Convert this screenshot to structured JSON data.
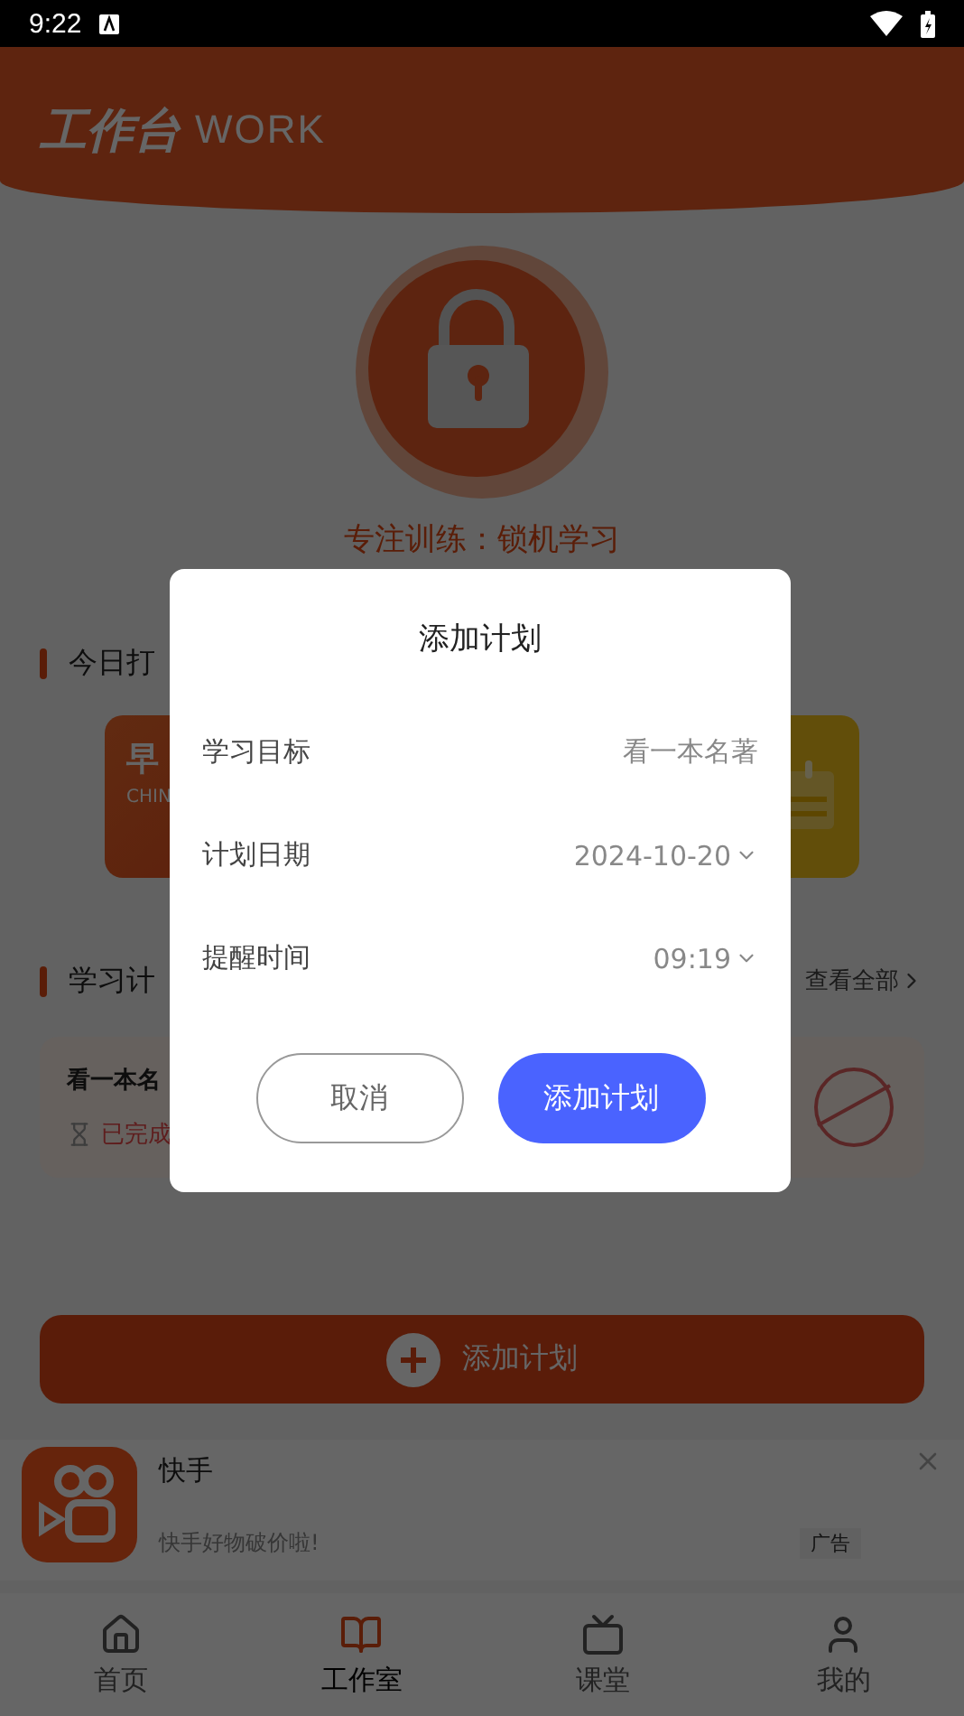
{
  "status_bar": {
    "time": "9:22"
  },
  "header": {
    "title": "工作台",
    "subtitle": "WORK"
  },
  "focus": {
    "label": "专注训练：锁机学习"
  },
  "checkin": {
    "title": "今日打",
    "cards": [
      {
        "title": "早",
        "subtitle": "CHIN",
        "kind": "orange"
      },
      {
        "kind": "yellow"
      }
    ]
  },
  "plans": {
    "title": "学习计",
    "more": "查看全部",
    "items": [
      {
        "name": "看一本名",
        "status": "已完成",
        "done": true
      }
    ]
  },
  "add_button": {
    "label": "添加计划"
  },
  "ad": {
    "name": "快手",
    "text": "快手好物破价啦!",
    "badge": "广告"
  },
  "tabs": [
    {
      "label": "首页",
      "selected": false,
      "kind": "home"
    },
    {
      "label": "工作室",
      "selected": true,
      "kind": "book"
    },
    {
      "label": "课堂",
      "selected": false,
      "kind": "tv"
    },
    {
      "label": "我的",
      "selected": false,
      "kind": "user"
    }
  ],
  "dialog": {
    "title": "添加计划",
    "fields": [
      {
        "label": "学习目标",
        "value": "看一本名著",
        "kind": "text"
      },
      {
        "label": "计划日期",
        "value": "2024-10-20",
        "kind": "select"
      },
      {
        "label": "提醒时间",
        "value": "09:19",
        "kind": "select"
      }
    ],
    "buttons": [
      {
        "label": "取消",
        "kind": "secondary"
      },
      {
        "label": "添加计划",
        "kind": "primary"
      }
    ]
  }
}
